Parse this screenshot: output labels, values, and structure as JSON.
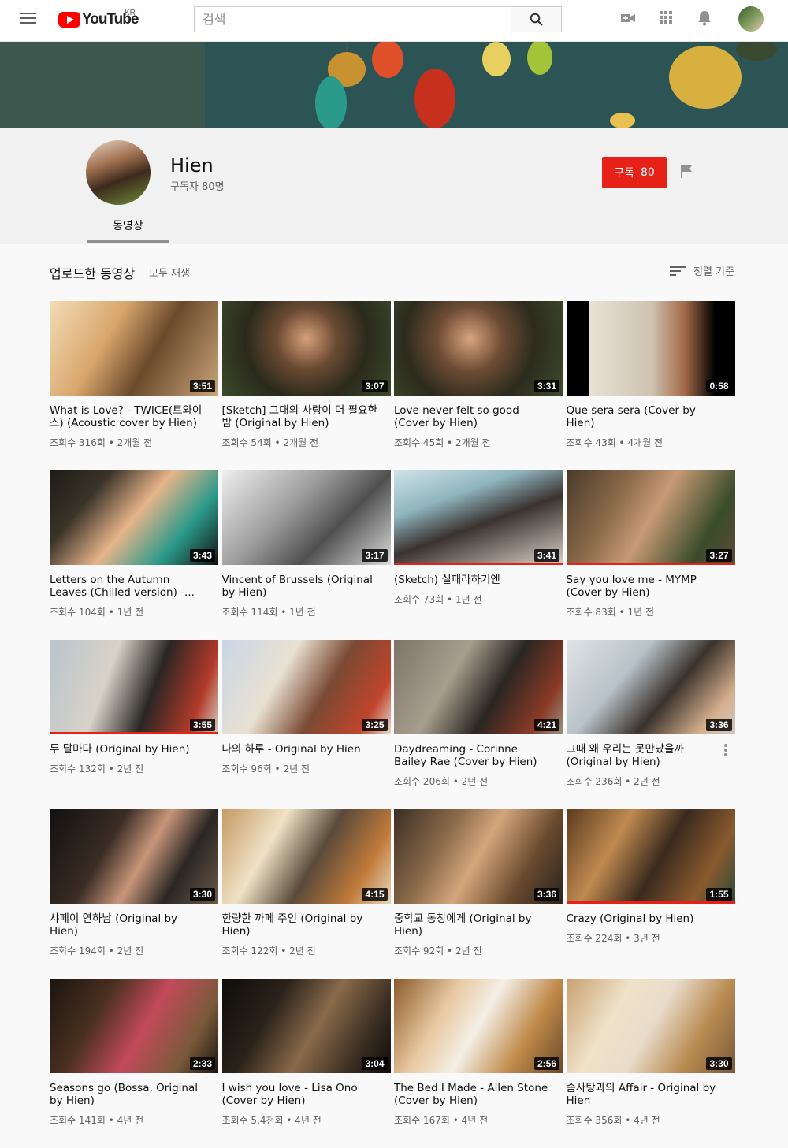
{
  "header": {
    "logo_text": "YouTube",
    "region": "KR",
    "search_placeholder": "검색"
  },
  "channel": {
    "name": "Hien",
    "subscribers": "구독자 80명",
    "subscribe_label": "구독",
    "subscribe_count": "80",
    "tab_videos": "동영상"
  },
  "section": {
    "title": "업로드한 동영상",
    "play_all": "모두 재생",
    "sort_label": "정렬 기준"
  },
  "colors": {
    "accent": "#e62117"
  },
  "videos": [
    {
      "title": "What is Love? - TWICE(트와이스) (Acoustic cover by Hien)",
      "meta": "조회수 316회 • 2개월 전",
      "duration": "3:51",
      "progress": 0,
      "bg": "linear-gradient(120deg,#f2ddb6 0%,#d9a66c 35%,#6b4a2c 60%,#c9a57a 100%)"
    },
    {
      "title": "[Sketch] 그대의 사랑이 더 필요한 밤 (Original by Hien)",
      "meta": "조회수 54회 • 2개월 전",
      "duration": "3:07",
      "progress": 0,
      "bg": "radial-gradient(circle at 50% 40%,#d6a07a 0%,#6b4a32 30%,#2a2a1c 60%,#3c4a2a 100%)"
    },
    {
      "title": "Love never felt so good (Cover by Hien)",
      "meta": "조회수 45회 • 2개월 전",
      "duration": "3:31",
      "progress": 0,
      "bg": "radial-gradient(circle at 45% 40%,#d8a47e 0%,#6e4c34 30%,#2c2b1e 60%,#3e4b2c 100%)"
    },
    {
      "title": "Que sera sera (Cover by Hien)",
      "meta": "조회수 43회 • 4개월 전",
      "duration": "0:58",
      "progress": 0,
      "bg": "linear-gradient(90deg,#000 0%,#000 13%,#e9e2d6 13%,#cfc3b2 50%,#a36a48 70%,#000 88%,#000 100%)"
    },
    {
      "title": "Letters on the Autumn Leaves (Chilled version) -...",
      "meta": "조회수 104회 • 1년 전",
      "duration": "3:43",
      "progress": 0,
      "bg": "linear-gradient(130deg,#1c1c18 0%,#3a3328 25%,#e7b48a 50%,#2b9a8a 75%,#111 100%)"
    },
    {
      "title": "Vincent of Brussels (Original by Hien)",
      "meta": "조회수 114회 • 1년 전",
      "duration": "3:17",
      "progress": 0,
      "bg": "linear-gradient(135deg,#efefef 0%,#9c9c9c 40%,#505050 65%,#dcdcdc 100%)"
    },
    {
      "title": "(Sketch) 실패라하기엔",
      "meta": "조회수 73회 • 1년 전",
      "duration": "3:41",
      "progress": 1,
      "bg": "linear-gradient(160deg,#cfe3e7 0%,#8fb5bd 30%,#3a3230 55%,#d9d0c6 100%)"
    },
    {
      "title": "Say you love me - MYMP (Cover by Hien)",
      "meta": "조회수 83회 • 1년 전",
      "duration": "3:27",
      "progress": 1,
      "bg": "linear-gradient(120deg,#4a3a2a 0%,#8a6a4a 30%,#c89a76 50%,#3a4c2a 80%,#5a4a3a 100%)"
    },
    {
      "title": "두 달마다 (Original by Hien)",
      "meta": "조회수 132회 • 2년 전",
      "duration": "3:55",
      "progress": 1,
      "bg": "linear-gradient(110deg,#b8c4cc 0%,#d8d2c8 35%,#2a2624 60%,#b23a2a 85%,#d8cfc2 100%)"
    },
    {
      "title": "나의 하루 - Original by Hien",
      "meta": "조회수 96회 • 2년 전",
      "duration": "3:25",
      "progress": 0,
      "bg": "linear-gradient(120deg,#c9d6e6 0%,#e9e1d2 35%,#7a4a34 60%,#c0442c 85%,#e4dccd 100%)"
    },
    {
      "title": "Daydreaming - Corinne Bailey Rae (Cover by Hien)",
      "meta": "조회수 206회 • 2년 전",
      "duration": "4:21",
      "progress": 0,
      "bg": "linear-gradient(120deg,#7a7468 0%,#a89e8e 35%,#2a2622 60%,#8a3a26 85%,#9a9282 100%)"
    },
    {
      "title": "그때 왜 우리는 못만났을까 (Original by Hien)",
      "meta": "조회수 236회 • 2년 전",
      "duration": "3:36",
      "progress": 0,
      "bg": "linear-gradient(130deg,#dfe3e6 0%,#b8c2c8 35%,#3a322c 60%,#d6b08e 85%,#cfcac4 100%)"
    },
    {
      "title": "샤페이 연하남 (Original by Hien)",
      "meta": "조회수 194회 • 2년 전",
      "duration": "3:30",
      "progress": 0,
      "bg": "linear-gradient(120deg,#111 0%,#3a2c24 35%,#c8967a 55%,#2a2624 75%,#6a5a4a 100%)"
    },
    {
      "title": "한량한 까페 주인 (Original by Hien)",
      "meta": "조회수 122회 • 2년 전",
      "duration": "4:15",
      "progress": 0,
      "bg": "linear-gradient(120deg,#c49a64 0%,#f0e2c6 30%,#5a4a3a 55%,#c07a3a 80%,#e8d8bc 100%)"
    },
    {
      "title": "중학교 동창에게 (Original by Hien)",
      "meta": "조회수 92회 • 2년 전",
      "duration": "3:36",
      "progress": 0,
      "bg": "linear-gradient(120deg,#3a2e24 0%,#8a6a4a 30%,#d4a67c 50%,#6a4a2e 75%,#2a2420 100%)"
    },
    {
      "title": "Crazy (Original by Hien)",
      "meta": "조회수 224회 • 3년 전",
      "duration": "1:55",
      "progress": 1,
      "bg": "linear-gradient(120deg,#5a3a20 0%,#c08a50 30%,#3a2a1e 55%,#8a5a2e 80%,#2a4a3a 100%)"
    },
    {
      "title": "Seasons go (Bossa, Original by Hien)",
      "meta": "조회수 141회 • 4년 전",
      "duration": "2:33",
      "progress": 0,
      "bg": "linear-gradient(120deg,#1a1410 0%,#4a3020 30%,#c24a5a 55%,#7a5a3a 80%,#1a1410 100%)"
    },
    {
      "title": "I wish you love - Lisa Ono (Cover by Hien)",
      "meta": "조회수 5.4천회 • 4년 전",
      "duration": "3:04",
      "progress": 0,
      "bg": "linear-gradient(120deg,#0e0c0a 0%,#2a221a 30%,#8a6a4a 55%,#3a2e22 80%,#0e0c0a 100%)"
    },
    {
      "title": "The Bed I Made - Allen Stone (Cover by Hien)",
      "meta": "조회수 167회 • 4년 전",
      "duration": "2:56",
      "progress": 0,
      "bg": "linear-gradient(120deg,#8a5a2a 0%,#e8c8a0 30%,#f4efe6 50%,#c08a4a 75%,#6a4a2a 100%)"
    },
    {
      "title": "솜사탕과의 Affair - Original by Hien",
      "meta": "조회수 356회 • 4년 전",
      "duration": "3:30",
      "progress": 0,
      "bg": "linear-gradient(120deg,#c8a070 0%,#efe2c8 30%,#e9dccb 50%,#b88a50 75%,#7a5a3a 100%)"
    }
  ]
}
